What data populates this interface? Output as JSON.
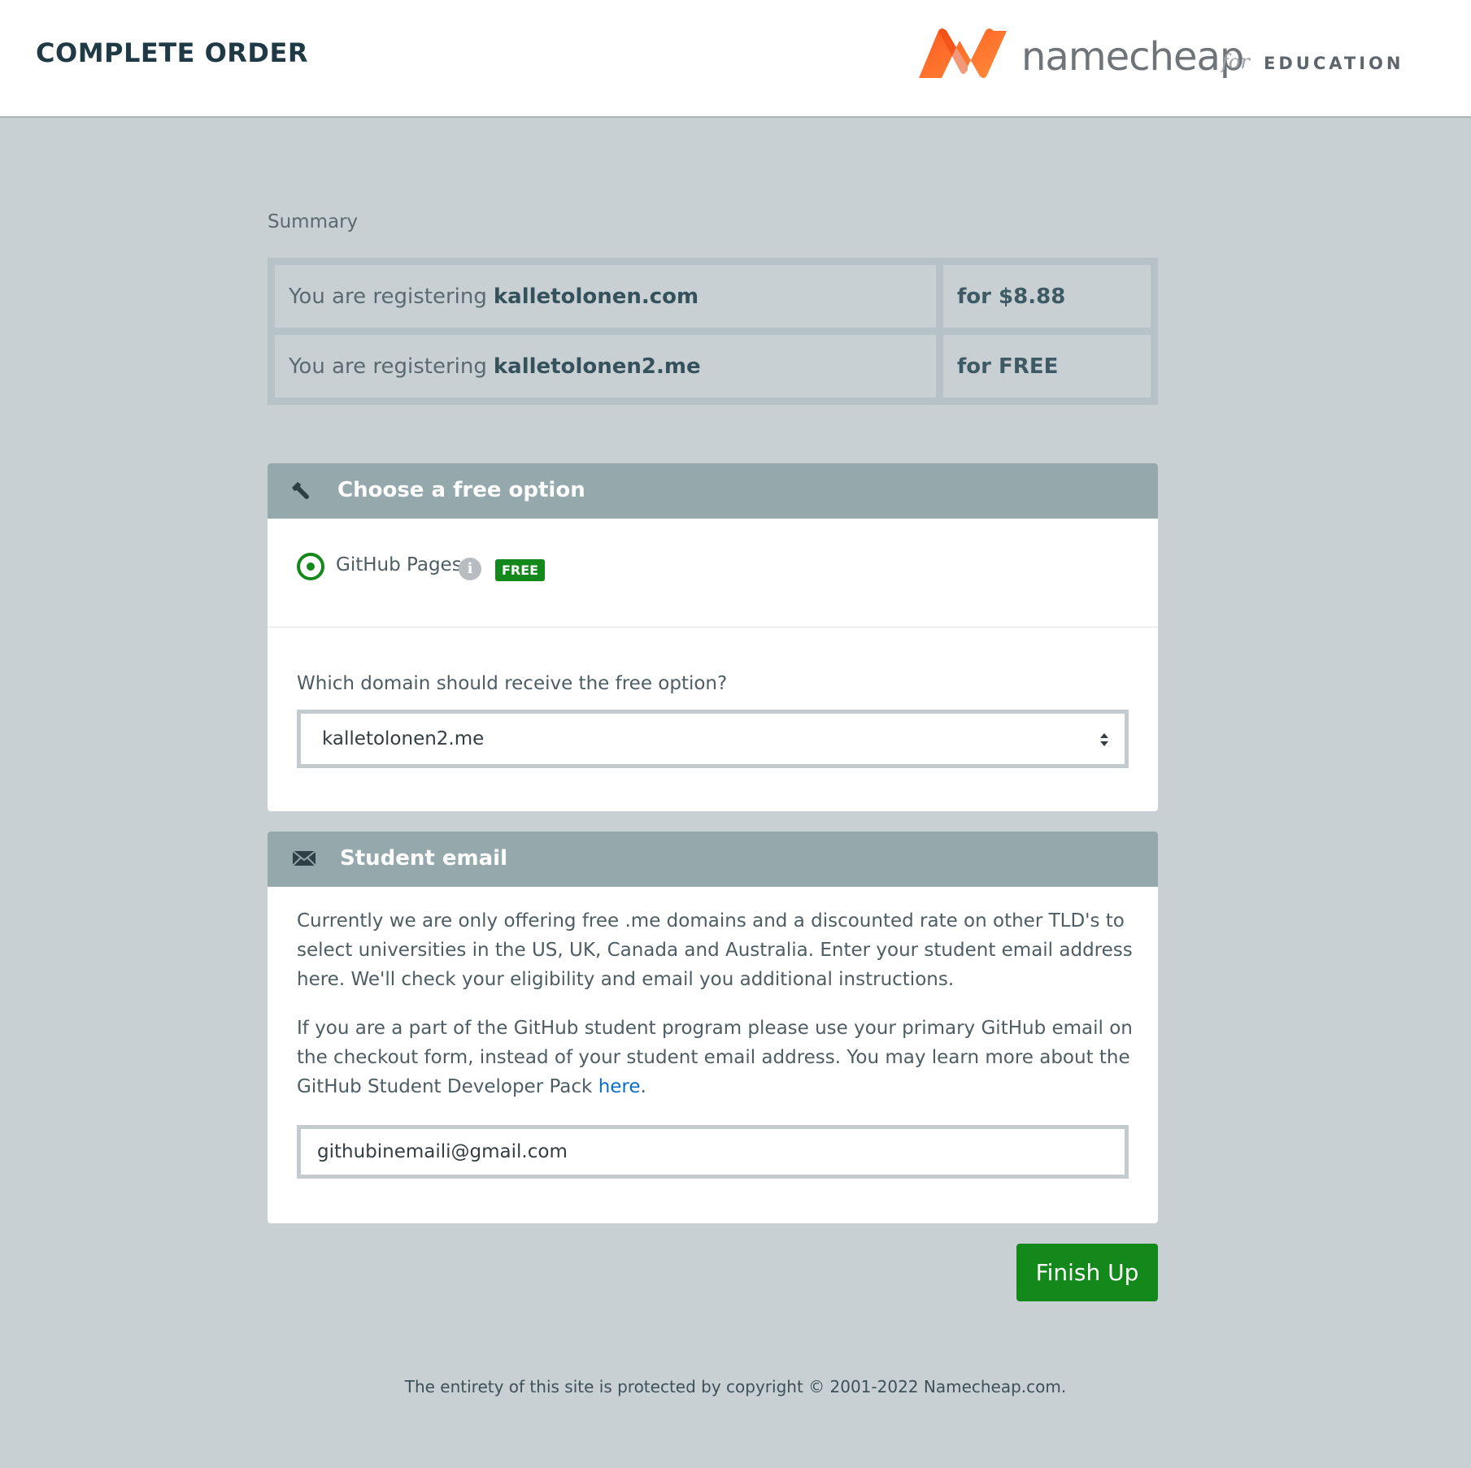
{
  "header": {
    "title": "COMPLETE ORDER",
    "brand": {
      "name": "namecheap",
      "for": "for",
      "edu": "EDUCATION"
    }
  },
  "summary": {
    "label": "Summary",
    "rows": [
      {
        "prefix": "You are registering",
        "domain": "kalletolonen.com",
        "price": "for $8.88"
      },
      {
        "prefix": "You are registering",
        "domain": "kalletolonen2.me",
        "price": "for FREE"
      }
    ]
  },
  "free_option": {
    "heading": "Choose a free option",
    "option_label": "GitHub Pages",
    "badge": "FREE",
    "question": "Which domain should receive the free option?",
    "selected_domain": "kalletolonen2.me"
  },
  "student_email": {
    "heading": "Student email",
    "paragraph1": "Currently we are only offering free .me domains and a discounted rate on other TLD's to select universities in the US, UK, Canada and Australia. Enter your student email address here. We'll check your eligibility and email you additional instructions.",
    "paragraph2_before": "If you are a part of the GitHub student program please use your primary GitHub email on the checkout form, instead of your student email address. You may learn more about the GitHub Student Developer Pack ",
    "paragraph2_link": "here",
    "paragraph2_after": ".",
    "email_value": "githubinemaili@gmail.com"
  },
  "actions": {
    "finish_label": "Finish Up"
  },
  "footer": {
    "copyright": "The entirety of this site is protected by copyright © 2001-2022 Namecheap.com."
  },
  "colors": {
    "accent_green": "#12891a",
    "header_gray": "#95a8ab",
    "brand_orange": "#f26122"
  },
  "icons": {
    "free_option": "wrench-icon",
    "student_email": "envelope-icon",
    "info": "info-icon",
    "select": "sort-arrows-icon"
  }
}
